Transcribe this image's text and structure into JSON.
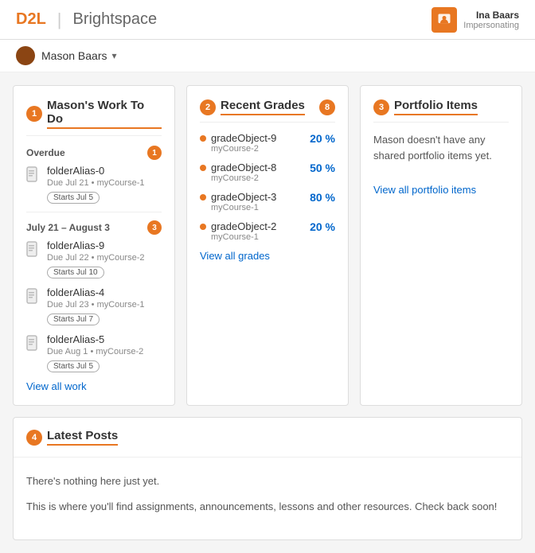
{
  "header": {
    "logo": "D2L",
    "divider": "|",
    "brand": "Brightspace",
    "user": {
      "name": "Ina Baars",
      "sub": "Impersonating"
    }
  },
  "userBar": {
    "name": "Mason Baars"
  },
  "workToDo": {
    "badge": "1",
    "title": "Mason's Work To Do",
    "overdue": {
      "label": "Overdue",
      "badge": "1",
      "items": [
        {
          "name": "folderAlias-0",
          "due": "Due Jul 21",
          "course": "myCourse-1",
          "starts": "Starts Jul 5"
        }
      ]
    },
    "julAug": {
      "label": "July 21 – August 3",
      "badge": "3",
      "items": [
        {
          "name": "folderAlias-9",
          "due": "Due Jul 22",
          "course": "myCourse-2",
          "starts": "Starts Jul 10"
        },
        {
          "name": "folderAlias-4",
          "due": "Due Jul 23",
          "course": "myCourse-1",
          "starts": "Starts Jul 7"
        },
        {
          "name": "folderAlias-5",
          "due": "Due Aug 1",
          "course": "myCourse-2",
          "starts": "Starts Jul 5"
        }
      ]
    },
    "viewAll": "View all work"
  },
  "recentGrades": {
    "badge": "2",
    "badgeCount": "8",
    "title": "Recent Grades",
    "grades": [
      {
        "name": "gradeObject-9",
        "course": "myCourse-2",
        "pct": "20 %"
      },
      {
        "name": "gradeObject-8",
        "course": "myCourse-2",
        "pct": "50 %"
      },
      {
        "name": "gradeObject-3",
        "course": "myCourse-1",
        "pct": "80 %"
      },
      {
        "name": "gradeObject-2",
        "course": "myCourse-1",
        "pct": "20 %"
      }
    ],
    "viewAll": "View all grades"
  },
  "portfolio": {
    "badge": "3",
    "title": "Portfolio Items",
    "emptyText": "Mason doesn't have any shared portfolio items yet.",
    "viewAll": "View all portfolio items"
  },
  "latestPosts": {
    "badge": "4",
    "title": "Latest Posts",
    "line1": "There's nothing here just yet.",
    "line2": "This is where you'll find assignments, announcements, lessons and other resources. Check back soon!"
  }
}
